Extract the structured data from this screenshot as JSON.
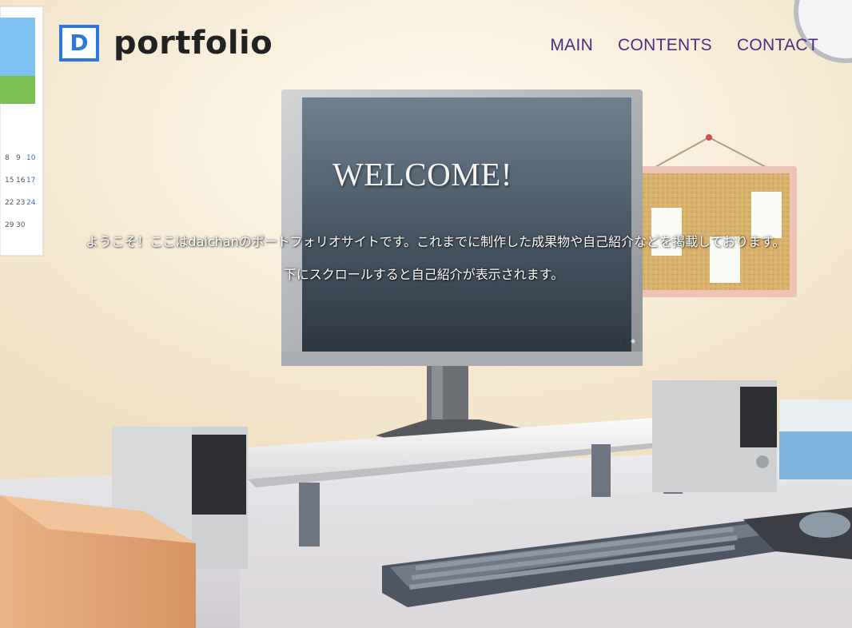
{
  "header": {
    "logo_letter": "D",
    "logo_text": "portfolio"
  },
  "nav": {
    "items": [
      "MAIN",
      "CONTENTS",
      "CONTACT"
    ]
  },
  "hero": {
    "heading": "WELCOME!",
    "line1": "ようこそ！ここはdaichanのポートフォリオサイトです。これまでに制作した成果物や自己紹介などを掲載しております。",
    "line2": "下にスクロールすると自己紹介が表示されます。"
  },
  "colors": {
    "logo_accent": "#2f78d8",
    "nav_text": "#4a2e80",
    "wall": "#f6ead2",
    "desk": "#e6e2e4"
  }
}
